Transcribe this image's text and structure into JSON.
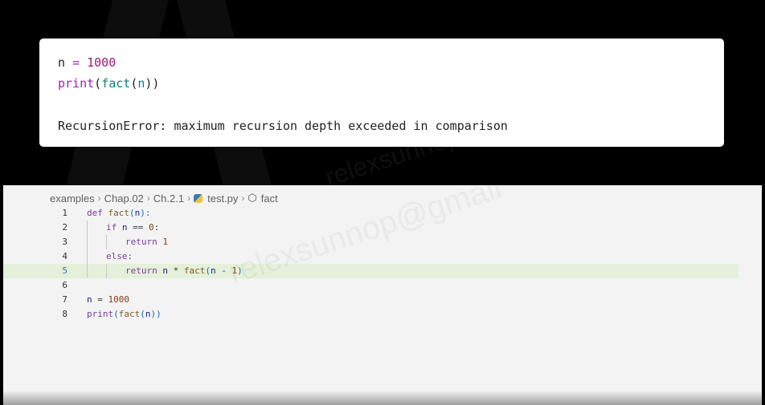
{
  "snippet": {
    "line1": {
      "var": "n",
      "op": "=",
      "num": "1000"
    },
    "line2": {
      "builtin": "print",
      "open1": "(",
      "fn": "fact",
      "open2": "(",
      "arg": "n",
      "close": "))"
    },
    "error": "RecursionError: maximum recursion depth exceeded in comparison"
  },
  "breadcrumb": [
    "examples",
    "Chap.02",
    "Ch.2.1",
    "test.py",
    "fact"
  ],
  "watermark": "relexsunnop@gmail",
  "code": [
    {
      "num": "1",
      "tokens": [
        [
          "t-kw",
          "def "
        ],
        [
          "t-fn",
          "fact"
        ],
        [
          "t-par",
          "("
        ],
        [
          "t-var",
          "n"
        ],
        [
          "t-par",
          "):"
        ]
      ]
    },
    {
      "num": "2",
      "tokens": [
        [
          "t-kw",
          "if "
        ],
        [
          "t-var",
          "n"
        ],
        [
          "",
          " == "
        ],
        [
          "t-num",
          "0"
        ],
        [
          "",
          ":"
        ]
      ]
    },
    {
      "num": "3",
      "tokens": [
        [
          "t-kw",
          "return "
        ],
        [
          "t-num",
          "1"
        ]
      ]
    },
    {
      "num": "4",
      "tokens": [
        [
          "t-kw",
          "else:"
        ]
      ]
    },
    {
      "num": "5",
      "tokens": [
        [
          "t-kw",
          "return "
        ],
        [
          "t-var",
          "n"
        ],
        [
          "",
          " * "
        ],
        [
          "t-fn",
          "fact"
        ],
        [
          "t-par",
          "("
        ],
        [
          "t-var",
          "n"
        ],
        [
          "",
          " - "
        ],
        [
          "t-num",
          "1"
        ],
        [
          "t-par",
          ")"
        ]
      ]
    },
    {
      "num": "6",
      "tokens": []
    },
    {
      "num": "7",
      "tokens": [
        [
          "t-var",
          "n"
        ],
        [
          "",
          " = "
        ],
        [
          "t-num",
          "1000"
        ]
      ]
    },
    {
      "num": "8",
      "tokens": [
        [
          "t-kw",
          "print"
        ],
        [
          "t-par",
          "("
        ],
        [
          "t-fn",
          "fact"
        ],
        [
          "t-par",
          "("
        ],
        [
          "t-var",
          "n"
        ],
        [
          "t-par",
          "))"
        ]
      ]
    }
  ],
  "highlighted_line": "5"
}
